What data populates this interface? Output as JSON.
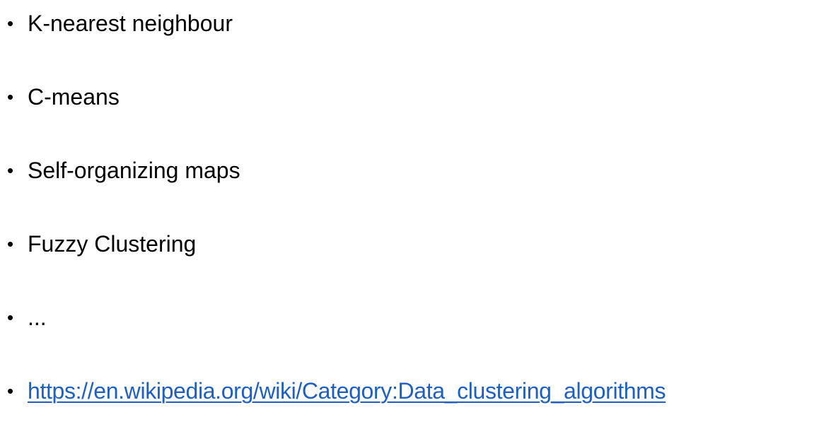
{
  "slide": {
    "bullet_symbol": "•",
    "items": [
      {
        "text": "K-nearest neighbour"
      },
      {
        "text": "C-means"
      },
      {
        "text": "Self-organizing maps"
      },
      {
        "text": "Fuzzy Clustering"
      },
      {
        "text": "..."
      }
    ],
    "link": {
      "text": "https://en.wikipedia.org/wiki/Category:Data_clustering_algorithms",
      "color": "#1f5fbf"
    }
  }
}
